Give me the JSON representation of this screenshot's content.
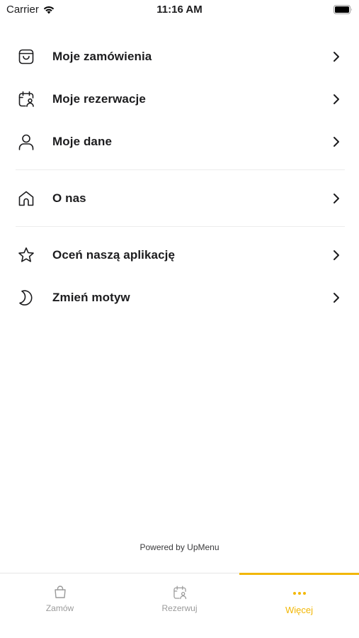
{
  "status_bar": {
    "carrier": "Carrier",
    "time": "11:16 AM"
  },
  "menu": {
    "group1": [
      {
        "label": "Moje zamówienia",
        "icon": "bag-icon"
      },
      {
        "label": "Moje rezerwacje",
        "icon": "calendar-person-icon"
      },
      {
        "label": "Moje dane",
        "icon": "person-icon"
      }
    ],
    "group2": [
      {
        "label": "O nas",
        "icon": "home-icon"
      }
    ],
    "group3": [
      {
        "label": "Oceń naszą aplikację",
        "icon": "star-icon"
      },
      {
        "label": "Zmień motyw",
        "icon": "moon-icon"
      }
    ]
  },
  "footer": {
    "powered_by": "Powered by UpMenu"
  },
  "tabbar": {
    "tabs": [
      {
        "label": "Zamów",
        "icon": "bag-icon"
      },
      {
        "label": "Rezerwuj",
        "icon": "calendar-person-icon"
      },
      {
        "label": "Więcej",
        "icon": "more-dots-icon"
      }
    ],
    "active_index": 2,
    "accent_color": "#f2b705"
  }
}
